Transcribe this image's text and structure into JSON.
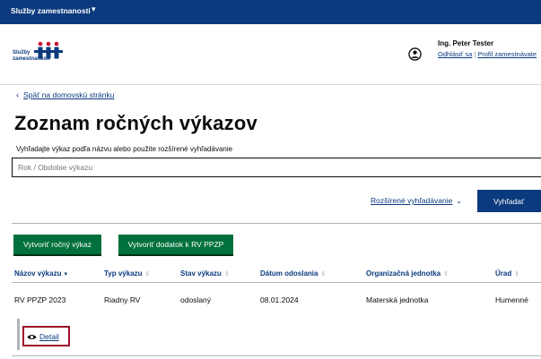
{
  "topbar": {
    "title": "Služby zamestnanosti",
    "caret": "▾"
  },
  "logo": {
    "text_line1": "Služby",
    "text_line2": "zamestnanosti"
  },
  "user": {
    "name": "Ing. Peter Tester",
    "logout": "Odhlásiť sa",
    "separator": "|",
    "profile": "Profil zamestnávate"
  },
  "nav": {
    "back_label": "Späť na domovskú stránku",
    "back_chevron": "‹"
  },
  "page": {
    "title": "Zoznam ročných výkazov",
    "hint": "Vyhľadajte výkaz podľa názvu alebo použite rozšírené vyhľadávanie"
  },
  "search": {
    "placeholder": "Rok / Obdobie výkazu",
    "value": ""
  },
  "advanced": {
    "label": "Rozšírené vyhľadávanie",
    "chevron": "⌄",
    "submit": "Vyhľadať"
  },
  "actions": {
    "create": "Vytvoriť ročný výkaz",
    "addendum": "Vytvoriť dodatok k RV PPZP"
  },
  "table": {
    "columns": [
      {
        "label": "Názov výkazu",
        "sort": "▾"
      },
      {
        "label": "Typ výkazu",
        "sort": "⇕"
      },
      {
        "label": "Stav výkazu",
        "sort": "⇕"
      },
      {
        "label": "Dátum odoslania",
        "sort": "⇕"
      },
      {
        "label": "Organizačná jednotka",
        "sort": "⇕"
      },
      {
        "label": "Úrad",
        "sort": "⇕"
      }
    ],
    "rows": [
      {
        "cells": [
          "RV PPZP 2023",
          "Riadny RV",
          "odoslaný",
          "08.01.2024",
          "Materská jednotka",
          "Humenné"
        ],
        "detail": "Detail"
      }
    ]
  },
  "colors": {
    "primary": "#0b3a7e",
    "green": "#00703c",
    "highlight": "#a0142a"
  }
}
